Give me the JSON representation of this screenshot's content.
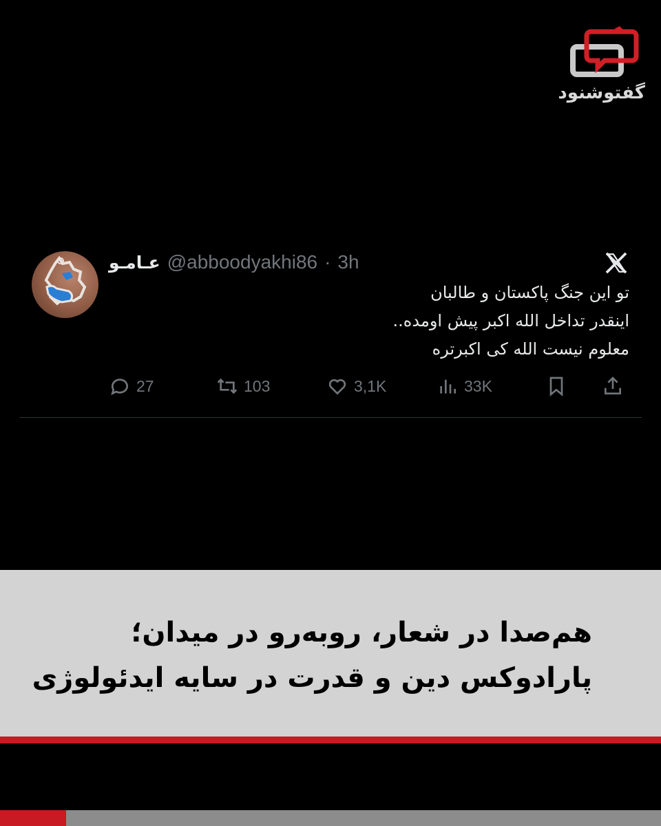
{
  "brand": {
    "logo_text": "گفتوشنود",
    "accent": "#c81a23"
  },
  "tweet": {
    "display_name": "عـامـو",
    "handle": "@abboodyakhi86",
    "separator": "·",
    "time": "3h",
    "lines": [
      "تو این جنگ پاکستان و طالبان",
      "اینقدر تداخل الله اکبر پیش اومده..",
      "معلوم نیست الله کی اکبرتره"
    ],
    "stats": {
      "replies": "27",
      "retweets": "103",
      "likes": "3,1K",
      "views": "33K"
    },
    "icons": [
      "reply-icon",
      "retweet-icon",
      "like-icon",
      "views-icon",
      "bookmark-icon",
      "share-icon",
      "x-logo-icon"
    ]
  },
  "headline": {
    "line1": "هم‌صدا در شعار، روبه‌رو در میدان؛",
    "line2": "پارادوکس دین و قدرت در سایه ایدئولوژی"
  }
}
